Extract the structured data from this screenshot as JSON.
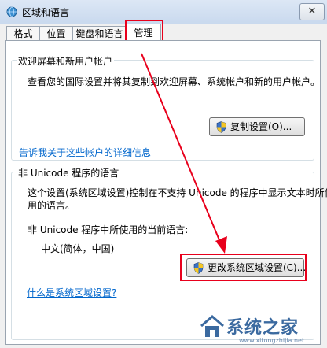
{
  "window": {
    "title": "区域和语言",
    "close_glyph": "✕"
  },
  "tabs": [
    {
      "label": "格式"
    },
    {
      "label": "位置"
    },
    {
      "label": "键盘和语言"
    },
    {
      "label": "管理"
    }
  ],
  "welcome_group": {
    "title": "欢迎屏幕和新用户帐户",
    "description": "查看您的国际设置并将其复制到欢迎屏幕、系统帐户和新的用户帐户。",
    "copy_button": "复制设置(O)...",
    "link": "告诉我关于这些帐户的详细信息"
  },
  "unicode_group": {
    "title": "非 Unicode 程序的语言",
    "description_line1": "这个设置(系统区域设置)控制在不支持 Unicode 的程序中显示文本时所使",
    "description_line2": "用的语言。",
    "current_label": "非 Unicode 程序中所使用的当前语言:",
    "current_value": "中文(简体，中国)",
    "change_button": "更改系统区域设置(C)...",
    "link": "什么是系统区域设置?"
  },
  "watermark": {
    "text": "系统之家",
    "url": "www.xitongzhijia.net"
  },
  "icons": {
    "app": "globe-icon",
    "shield": "uac-shield-icon",
    "close": "close-icon",
    "watermark": "house-logo-icon"
  },
  "colors": {
    "highlight": "#e8001c",
    "link": "#0066cc"
  }
}
